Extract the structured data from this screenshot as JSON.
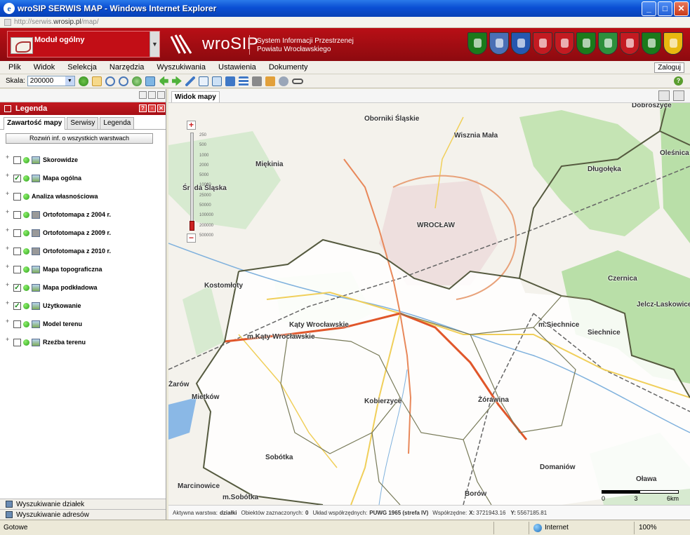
{
  "window": {
    "title": "wroSIP SERWIS MAP - Windows Internet Explorer",
    "minimize": "_",
    "maximize": "□",
    "close": "✕"
  },
  "address": {
    "prefix": "http://serwis.",
    "domain": "wrosip.pl",
    "suffix": "/map/"
  },
  "banner": {
    "module_label": "Moduł ogólny",
    "logo_text": "wroSIP",
    "subtitle_line1": "System Informacji Przestrzenej",
    "subtitle_line2": "Powiatu Wrocławskiego",
    "crest_colors": [
      "#1b7a1b",
      "#4a6fb5",
      "#2557b0",
      "#c31a21",
      "#c31a21",
      "#1b7a1b",
      "#2d8f3c",
      "#c31a21",
      "#1b7a1b",
      "#e8b810"
    ]
  },
  "menu": {
    "items": [
      "Plik",
      "Widok",
      "Selekcja",
      "Narzędzia",
      "Wyszukiwania",
      "Ustawienia",
      "Dokumenty"
    ],
    "login": "Zaloguj"
  },
  "toolbar": {
    "scale_label": "Skala:",
    "scale_value": "200000",
    "help": "?"
  },
  "legend_panel": {
    "title": "Legenda",
    "tabs": [
      "Zawartość mapy",
      "Serwisy",
      "Legenda"
    ],
    "expand_button": "Rozwiń inf. o wszystkich warstwach",
    "layers": [
      {
        "name": "Skorowidze",
        "checked": "",
        "icon": "map-layer-icon"
      },
      {
        "name": "Mapa ogólna",
        "checked": "✓",
        "icon": "map-layer-icon"
      },
      {
        "name": "Analiza własnościowa",
        "checked": "",
        "icon": "none"
      },
      {
        "name": "Ortofotomapa z 2004 r.",
        "checked": "",
        "icon": "ortho-layer-icon"
      },
      {
        "name": "Ortofotomapa z 2009 r.",
        "checked": "",
        "icon": "ortho-layer-icon"
      },
      {
        "name": "Ortofotomapa z 2010 r.",
        "checked": "",
        "icon": "ortho-layer-icon"
      },
      {
        "name": "Mapa topograficzna",
        "checked": "",
        "icon": "map-layer-icon"
      },
      {
        "name": "Mapa podkładowa",
        "checked": "✓",
        "icon": "map-layer-icon"
      },
      {
        "name": "Użytkowanie",
        "checked": "✓",
        "icon": "map-layer-icon"
      },
      {
        "name": "Model terenu",
        "checked": "",
        "icon": "map-layer-icon"
      },
      {
        "name": "Rzeźba terenu",
        "checked": "",
        "icon": "map-layer-icon"
      }
    ],
    "bottom": [
      "Wyszukiwanie działek",
      "Wyszukiwanie adresów"
    ]
  },
  "map": {
    "tab": "Widok mapy",
    "zoom_in": "+",
    "zoom_out": "−",
    "zoom_scales": [
      "250",
      "500",
      "1000",
      "2000",
      "5000",
      "10000",
      "25000",
      "50000",
      "100000",
      "200000",
      "500000"
    ],
    "places": [
      "Dobroszyce",
      "Oborniki Śląskie",
      "Wisznia Mała",
      "Oleśnica",
      "Miękinia",
      "Długołęka",
      "Środa Śląska",
      "WROCŁAW",
      "Kostomłoty",
      "Czernica",
      "Jelcz-Laskowice",
      "Kąty Wrocławskie",
      "m.Kąty Wrocławskie",
      "m.Siechnice",
      "Siechnice",
      "Żarów",
      "Mietków",
      "Kobierzyce",
      "Żórawina",
      "Sobótka",
      "Domaniów",
      "Marcinowice",
      "m.Sobótka",
      "Borów",
      "Oława"
    ],
    "scalebar": [
      "0",
      "3",
      "6km"
    ],
    "colors": {
      "background": "#f4f2ec",
      "forest": "#b9dfa8",
      "water": "#8ab8e6",
      "road_main": "#e0562a",
      "road_secondary": "#f0cf5a",
      "boundary": "#555a3f"
    }
  },
  "statusline": {
    "active_layer_label": "Aktywna warstwa:",
    "active_layer": "działki",
    "selected_label": "Obiektów zaznaczonych:",
    "selected": "0",
    "crs_label": "Układ współrzędnych:",
    "crs": "PUWG 1965 (strefa IV)",
    "coords_label": "Współrzędne:",
    "x_label": "X:",
    "x": "3721943.16",
    "y_label": "Y:",
    "y": "5567185.81"
  },
  "iestatus": {
    "ready": "Gotowe",
    "zone": "Internet",
    "zoom": "100%"
  }
}
